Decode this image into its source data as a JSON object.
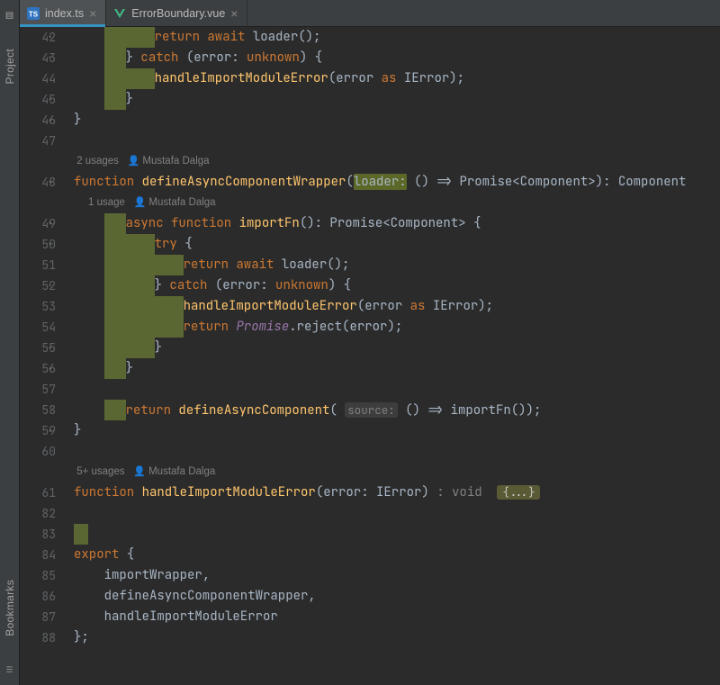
{
  "tool_stripe": {
    "project": "Project",
    "bookmarks": "Bookmarks"
  },
  "tabs": [
    {
      "label": "index.ts",
      "icon": "ts",
      "active": true
    },
    {
      "label": "ErrorBoundary.vue",
      "icon": "vue",
      "active": false
    }
  ],
  "meta": {
    "usages_2": "2 usages",
    "usages_1": "1 usage",
    "usages_5": "5+ usages",
    "author": "Mustafa Dalga"
  },
  "gutter": [
    "42",
    "43",
    "44",
    "45",
    "46",
    "47",
    "",
    "48",
    "",
    "49",
    "50",
    "51",
    "52",
    "53",
    "54",
    "55",
    "56",
    "57",
    "58",
    "59",
    "60",
    "",
    "61",
    "82",
    "83",
    "84",
    "85",
    "86",
    "87",
    "88"
  ],
  "code": {
    "l42_ret": "return await",
    "l42_call": "loader()",
    "l43_catch": "catch",
    "l43_err": "error",
    "l43_unk": "unknown",
    "l44_fn": "handleImportModuleError",
    "l44_as": "as",
    "l44_t": "IError",
    "l48_fn": "function",
    "l48_name": "defineAsyncComponentWrapper",
    "l48_param": "loader:",
    "l48_sig": "() => Promise<Component>): Component",
    "l49_async": "async function",
    "l49_name": "importFn",
    "l49_ret": "(): Promise<Component> {",
    "l50_try": "try",
    "l51_ret": "return await",
    "l51_call": "loader()",
    "l52_catch": "catch",
    "l52_err": "error",
    "l52_unk": "unknown",
    "l53_fn": "handleImportModuleError",
    "l53_as": "as",
    "l53_t": "IError",
    "l54_ret": "return",
    "l54_prom": "Promise",
    "l54_rej": ".reject(",
    "l54_arg": "error",
    "l58_ret": "return",
    "l58_fn": "defineAsyncComponent",
    "l58_hint": "source:",
    "l58_lam": "() => importFn())",
    "l61_fn": "function",
    "l61_name": "handleImportModuleError",
    "l61_p": "(error: IError)",
    "l61_void": ": void",
    "l61_fold": "{...}",
    "l84_exp": "export",
    "l85": "importWrapper",
    "l86": "defineAsyncComponentWrapper",
    "l87": "handleImportModuleError"
  }
}
